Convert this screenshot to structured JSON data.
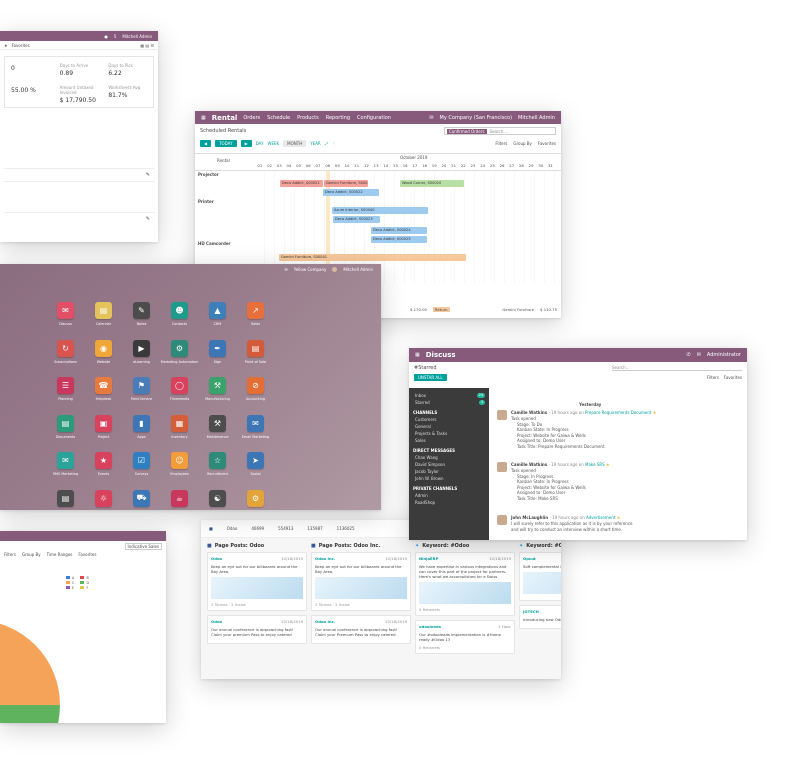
{
  "kpi_window": {
    "topbar": {
      "user": "Mitchell Admin",
      "notif": "5"
    },
    "search": {
      "filter_label": "Favorites"
    },
    "stats": [
      {
        "label": "",
        "value": "0"
      },
      {
        "label": "Days to Arrive",
        "value": "0.89"
      },
      {
        "label": "Days to Pick",
        "value": "6.22"
      },
      {
        "label": "",
        "value": "55.00 %"
      },
      {
        "label": "Amount Untaxed Invoiced",
        "value": "$ 17,790.50"
      },
      {
        "label": "Worksheets Avg",
        "value": "81.7%"
      }
    ]
  },
  "rental_window": {
    "app": "Rental",
    "menu": [
      "Orders",
      "Schedule",
      "Products",
      "Reporting",
      "Configuration"
    ],
    "company": "My Company (San Francisco)",
    "user": "Mitchell Admin",
    "breadcrumb": "Scheduled Rentals",
    "search_facet": "Confirmed Orders",
    "search_placeholder": "Search...",
    "today_label": "TODAY",
    "scales": [
      "DAY",
      "WEEK",
      "MONTH",
      "YEAR"
    ],
    "filters": [
      "Filters",
      "Group By",
      "Favorites"
    ],
    "month": "October 2019",
    "column_label": "Rental",
    "days": [
      "01",
      "02",
      "03",
      "04",
      "05",
      "06",
      "07",
      "08",
      "09",
      "10",
      "11",
      "12",
      "13",
      "14",
      "15",
      "16",
      "17",
      "18",
      "19",
      "20",
      "21",
      "22",
      "23",
      "24",
      "25",
      "26",
      "27",
      "28",
      "29",
      "30",
      "31"
    ],
    "groups": [
      "Projector",
      "Printer",
      "HD Camcorder"
    ],
    "bars": [
      {
        "label": "Deco Addict, S00021",
        "color": "red"
      },
      {
        "label": "Gemini Furniture, S00019",
        "color": "red"
      },
      {
        "label": "Wood Corner, S00020",
        "color": "green"
      },
      {
        "label": "Deco Addict, S00022",
        "color": "blue"
      },
      {
        "label": "Azure Interior, S00040",
        "color": "blue"
      },
      {
        "label": "Deco Addict, S00023",
        "color": "blue"
      },
      {
        "label": "Deco Addict, S00024",
        "color": "blue"
      },
      {
        "label": "Deco Addict, S00025",
        "color": "blue"
      },
      {
        "label": "Gemini Furniture, S00041",
        "color": "orange"
      }
    ],
    "totals": [
      {
        "label": "$ 170.00",
        "tag": "Return"
      },
      {
        "label": "Gemini Furniture",
        "tag": "$ 110.75"
      }
    ]
  },
  "home_window": {
    "company": "Yellow Company",
    "user": "Mitchell Admin",
    "apps": [
      {
        "name": "Discuss",
        "color": "#e24e65",
        "icon": "chat-icon"
      },
      {
        "name": "Calendar",
        "color": "#e3c35c",
        "icon": "calendar-icon"
      },
      {
        "name": "Notes",
        "color": "#4c4c4c",
        "icon": "note-icon"
      },
      {
        "name": "Contacts",
        "color": "#1f9b8e",
        "icon": "contacts-icon"
      },
      {
        "name": "CRM",
        "color": "#3d7fb8",
        "icon": "crm-icon"
      },
      {
        "name": "Sales",
        "color": "#e76f3b",
        "icon": "sales-icon"
      },
      {
        "name": "",
        "color": "",
        "icon": ""
      },
      {
        "name": "Subscriptions",
        "color": "#d9534f",
        "icon": "subscriptions-icon"
      },
      {
        "name": "Website",
        "color": "#f0a73a",
        "icon": "website-icon"
      },
      {
        "name": "eLearning",
        "color": "#3a3a3a",
        "icon": "elearning-icon"
      },
      {
        "name": "Marketing Automation",
        "color": "#2e8b7a",
        "icon": "automation-icon"
      },
      {
        "name": "Sign",
        "color": "#3c76b5",
        "icon": "sign-icon"
      },
      {
        "name": "Point of Sale",
        "color": "#d35b3a",
        "icon": "pos-icon"
      },
      {
        "name": "",
        "color": "",
        "icon": ""
      },
      {
        "name": "Planning",
        "color": "#c9375c",
        "icon": "planning-icon"
      },
      {
        "name": "Helpdesk",
        "color": "#e77b3e",
        "icon": "helpdesk-icon"
      },
      {
        "name": "Field Service",
        "color": "#4a7db8",
        "icon": "field-service-icon"
      },
      {
        "name": "Timesheets",
        "color": "#d8425d",
        "icon": "timesheets-icon"
      },
      {
        "name": "Manufacturing",
        "color": "#3aa36b",
        "icon": "manufacturing-icon"
      },
      {
        "name": "Accounting",
        "color": "#e36f35",
        "icon": "accounting-icon"
      },
      {
        "name": "",
        "color": "",
        "icon": ""
      },
      {
        "name": "Documents",
        "color": "#2c9b7c",
        "icon": "documents-icon"
      },
      {
        "name": "Project",
        "color": "#d8425d",
        "icon": "project-icon"
      },
      {
        "name": "Apps",
        "color": "#3c76b5",
        "icon": "apps-icon"
      },
      {
        "name": "Inventory",
        "color": "#d45d3a",
        "icon": "inventory-icon"
      },
      {
        "name": "Maintenance",
        "color": "#4d4d4d",
        "icon": "maintenance-icon"
      },
      {
        "name": "Email Marketing",
        "color": "#3c76b5",
        "icon": "email-marketing-icon"
      },
      {
        "name": "",
        "color": "",
        "icon": ""
      },
      {
        "name": "SMS Marketing",
        "color": "#2aa39a",
        "icon": "sms-icon"
      },
      {
        "name": "Events",
        "color": "#d8425d",
        "icon": "events-icon"
      },
      {
        "name": "Surveys",
        "color": "#2f7fc1",
        "icon": "surveys-icon"
      },
      {
        "name": "Employees",
        "color": "#f39c3a",
        "icon": "employees-icon"
      },
      {
        "name": "Recruitment",
        "color": "#2e8b7a",
        "icon": "recruitment-icon"
      },
      {
        "name": "Social",
        "color": "#3c76b5",
        "icon": "social-icon"
      },
      {
        "name": "",
        "color": "",
        "icon": ""
      },
      {
        "name": "Expenses",
        "color": "#4d4d4d",
        "icon": "expenses-icon"
      },
      {
        "name": "Leaves",
        "color": "#d8425d",
        "icon": "leaves-icon"
      },
      {
        "name": "Fleet",
        "color": "#3c76b5",
        "icon": "fleet-icon"
      },
      {
        "name": "Lunch",
        "color": "#c9375c",
        "icon": "lunch-icon"
      },
      {
        "name": "Appraisal",
        "color": "#4d4d4d",
        "icon": "appraisal-icon"
      },
      {
        "name": "Settings",
        "color": "#e3a43a",
        "icon": "settings-icon"
      },
      {
        "name": "",
        "color": "",
        "icon": ""
      }
    ]
  },
  "discuss_window": {
    "app": "Discuss",
    "user": "Administrator",
    "breadcrumb": "#Starred",
    "mark_all": "UNSTAR ALL",
    "search_placeholder": "Search...",
    "filters": [
      "Filters",
      "Favorites"
    ],
    "day_label": "Yesterday",
    "sidebar": {
      "inbox": "Inbox",
      "inbox_count": "24",
      "starred": "Starred",
      "starred_count": "4",
      "channels_title": "CHANNELS",
      "channels": [
        "Customers",
        "General",
        "Projects & Tasks",
        "Sales"
      ],
      "dm_title": "DIRECT MESSAGES",
      "dms": [
        "Chao Wang",
        "David Simpson",
        "Jacob Taylor",
        "John W. Brown"
      ],
      "private_title": "PRIVATE CHANNELS",
      "privates": [
        "Admin",
        "RoadShop"
      ]
    },
    "messages": [
      {
        "author": "Camille Watkins",
        "meta": "- 19 hours ago on",
        "link": "Prepare Requirements Document",
        "lines": [
          "Task opened",
          "Stage: To Do",
          "Kanban State: In Progress",
          "Project: Website for Gaiwa & Wells",
          "Assigned to: Demo User",
          "Task Title: Prepare Requirements Document"
        ]
      },
      {
        "author": "Camille Watkins",
        "meta": "- 19 hours ago on",
        "link": "Make SRS",
        "lines": [
          "Task opened",
          "Stage: In Progress",
          "Kanban State: In Progress",
          "Project: Website for Gaiwa & Wells",
          "Assigned to: Demo User",
          "Task Title: Make SRS"
        ]
      },
      {
        "author": "John McLaughlin",
        "meta": "- 19 hours ago on",
        "link": "Advertisement",
        "lines": [
          "I will surely refer to this application as it is by your reference",
          "and will try to conduct an interview within a short time."
        ]
      }
    ]
  },
  "pie_window": {
    "facet": "Indicative Sales",
    "filters": [
      "Filters",
      "Group By",
      "Time Ranges",
      "Favorites"
    ],
    "legend": [
      "A",
      "B",
      "C",
      "D",
      "E",
      "F"
    ],
    "chart_data": {
      "type": "pie",
      "values": [
        25,
        75
      ],
      "colors": [
        "#f6a35a",
        "#5fb35e"
      ]
    }
  },
  "social_window": {
    "account": "Odoo",
    "stats": [
      {
        "label": "46699"
      },
      {
        "label": "554913"
      },
      {
        "label": "135987"
      },
      {
        "label": "1136025"
      }
    ],
    "columns": [
      {
        "title": "Page Posts: Odoo",
        "cards": [
          {
            "author": "Odoo",
            "date": "10/18/2019",
            "text": "Keep an eye out for our billboards around the Bay Area.",
            "foot": "2 Shares · 2 Views"
          },
          {
            "author": "Odoo",
            "date": "10/18/2019",
            "text": "Our annual conference is approaching fast! Claim your premium Pass to enjoy catered",
            "foot": ""
          }
        ]
      },
      {
        "title": "Page Posts: Odoo Inc.",
        "cards": [
          {
            "author": "Odoo Inc.",
            "date": "10/18/2019",
            "text": "Keep an eye out for our billboards around the Bay Area.",
            "foot": "2 Shares · 2 Views"
          },
          {
            "author": "Odoo Inc.",
            "date": "10/18/2019",
            "text": "Our annual conference is approaching fast! Claim your Premium Pass to enjoy catered",
            "foot": ""
          }
        ]
      },
      {
        "title": "Keyword: #Odoo",
        "cards": [
          {
            "author": "NinjaERP",
            "date": "10/18/2019",
            "text": "We have expertise in various integrations and can cover this part of the project for partners. Here's what we accomplished for a Swiss",
            "foot": "0 Retweets"
          },
          {
            "author": "odooleads",
            "date": "1 Hour",
            "text": "Our #odooleads implementation is #Home ready #Odoo 13",
            "foot": "0 Retweets"
          }
        ]
      },
      {
        "title": "Keyword: #O",
        "cards": [
          {
            "author": "Opcut",
            "date": "",
            "text": "Soft complemental @THEMCASE...",
            "foot": ""
          },
          {
            "author": "JOTECH",
            "date": "",
            "text": "Introducing new Odoo...",
            "foot": ""
          }
        ]
      }
    ]
  }
}
